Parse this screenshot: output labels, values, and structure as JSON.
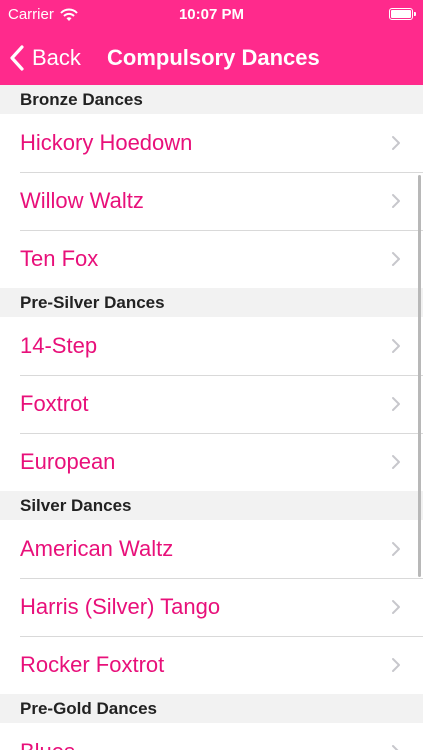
{
  "status_bar": {
    "carrier": "Carrier",
    "time": "10:07 PM"
  },
  "nav_bar": {
    "back_label": "Back",
    "title": "Compulsory Dances"
  },
  "colors": {
    "accent": "#ff2a8c",
    "row_text": "#e8107a",
    "section_bg": "#f2f2f2"
  },
  "sections": [
    {
      "header": "Bronze Dances",
      "items": [
        "Hickory Hoedown",
        "Willow Waltz",
        "Ten Fox"
      ]
    },
    {
      "header": "Pre-Silver Dances",
      "items": [
        "14-Step",
        "Foxtrot",
        "European"
      ]
    },
    {
      "header": "Silver Dances",
      "items": [
        "American Waltz",
        "Harris (Silver) Tango",
        "Rocker Foxtrot"
      ]
    },
    {
      "header": "Pre-Gold Dances",
      "items": [
        "Blues"
      ]
    }
  ]
}
